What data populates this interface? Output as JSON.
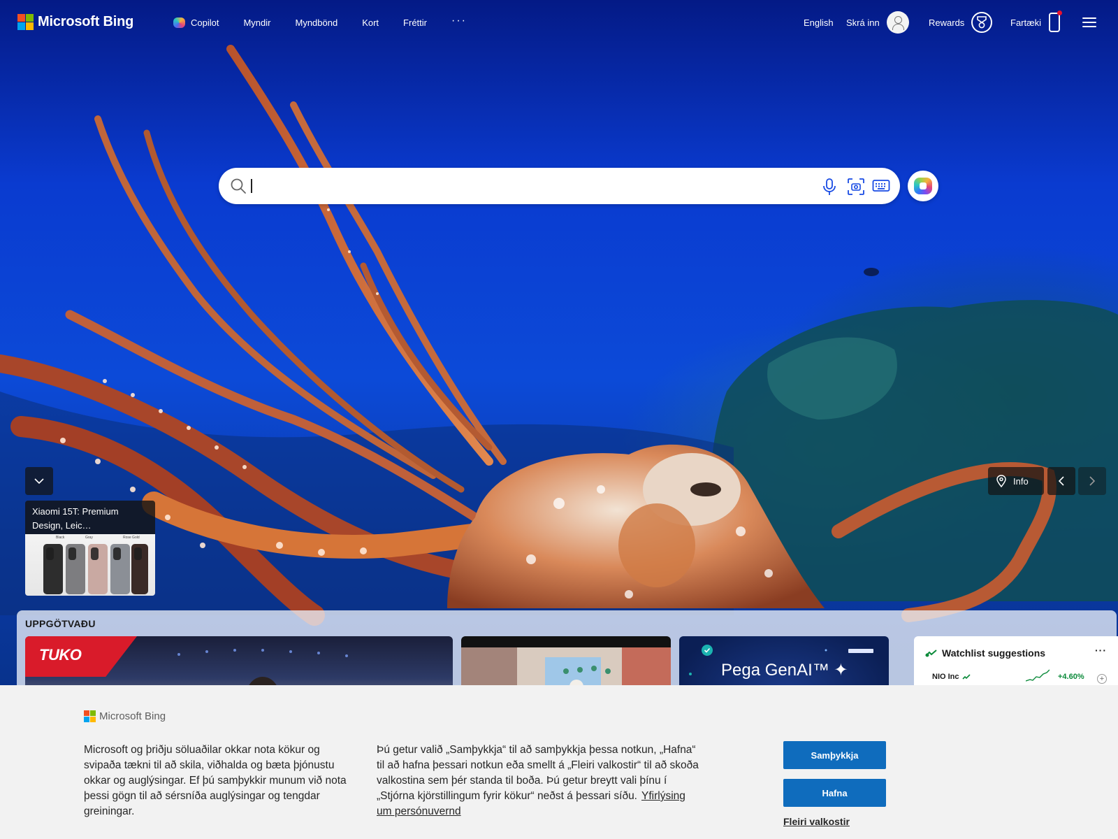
{
  "colors": {
    "ms_red": "#f25022",
    "ms_green": "#7fba00",
    "ms_blue": "#00a4ef",
    "ms_yellow": "#ffb900",
    "accent_button": "#0f6cbd",
    "ocean_top": "#041a86",
    "ocean_mid": "#0c4ad8",
    "stock_up": "#0b8a3a",
    "tuko_red": "#d91b2a"
  },
  "header": {
    "brand": "Microsoft Bing",
    "nav": [
      {
        "label": "Copilot",
        "icon": "copilot-icon"
      },
      {
        "label": "Myndir"
      },
      {
        "label": "Myndbönd"
      },
      {
        "label": "Kort"
      },
      {
        "label": "Fréttir"
      }
    ],
    "more_label": "···",
    "language": "English",
    "signin": "Skrá inn",
    "rewards": "Rewards",
    "mobile": "Fartæki"
  },
  "search": {
    "placeholder": "",
    "value": "",
    "icons": [
      "search-icon",
      "microphone-icon",
      "visual-search-icon",
      "keyboard-icon"
    ]
  },
  "promo": {
    "title": "Xiaomi 15T: Premium Design, Leic…",
    "variants": [
      "Black",
      "Gray",
      "Rose Gold"
    ]
  },
  "image_controls": {
    "info": "Info"
  },
  "discover": {
    "title": "UPPGÖTVAÐU",
    "cards": [
      {
        "brand": "TUKO",
        "kind": "news"
      },
      {
        "kind": "news"
      },
      {
        "title": "Pega GenAI™ ✦",
        "kind": "ad"
      }
    ],
    "watchlist": {
      "title": "Watchlist suggestions",
      "more": "···",
      "rows": [
        {
          "name": "NIO Inc",
          "change": "+4.60%"
        }
      ]
    }
  },
  "cookie": {
    "brand": "Microsoft Bing",
    "col1": "Microsoft og þriðju söluaðilar okkar nota kökur og svipaða tækni til að skila, viðhalda og bæta þjónustu okkar og auglýsingar. Ef þú samþykkir munum við nota þessi gögn til að sérsníða auglýsingar og tengdar greiningar.",
    "col2": "Þú getur valið „Samþykkja“ til að samþykkja þessa notkun, „Hafna“ til að hafna þessari notkun eða smellt á „Fleiri valkostir“ til að skoða valkostina sem þér standa til boða. Þú getur breytt vali þínu í „Stjórna kjörstillingum fyrir kökur“ neðst á þessari síðu.",
    "privacy_link": "Yfirlýsing um persónuvernd",
    "accept": "Samþykkja",
    "reject": "Hafna",
    "more_options": "Fleiri valkostir"
  }
}
